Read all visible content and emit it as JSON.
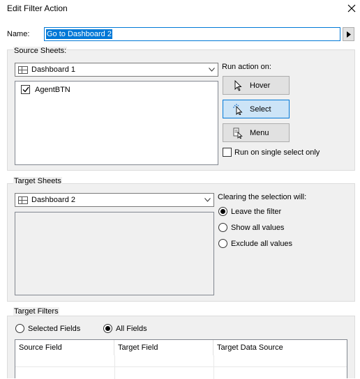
{
  "dialog": {
    "title": "Edit Filter Action"
  },
  "name_field": {
    "label": "Name:",
    "value": "Go to Dashboard 2"
  },
  "source": {
    "group_label": "Source Sheets:",
    "selected": "Dashboard 1",
    "sheets": [
      {
        "label": "AgentBTN",
        "checked": true
      }
    ]
  },
  "run_action": {
    "label": "Run action on:",
    "buttons": [
      {
        "label": "Hover",
        "icon": "pointer-icon"
      },
      {
        "label": "Select",
        "icon": "click-pointer-icon",
        "active": true
      },
      {
        "label": "Menu",
        "icon": "menu-icon"
      }
    ],
    "single_select_label": "Run on single select only"
  },
  "target": {
    "group_label": "Target Sheets",
    "selected": "Dashboard 2",
    "clearing_label": "Clearing the selection will:",
    "options": [
      {
        "label": "Leave the filter",
        "selected": true
      },
      {
        "label": "Show all values",
        "selected": false
      },
      {
        "label": "Exclude all values",
        "selected": false
      }
    ]
  },
  "filters": {
    "group_label": "Target Filters",
    "options": [
      {
        "label": "Selected Fields",
        "selected": false
      },
      {
        "label": "All Fields",
        "selected": true
      }
    ],
    "columns": [
      "Source Field",
      "Target Field",
      "Target Data Source"
    ]
  }
}
